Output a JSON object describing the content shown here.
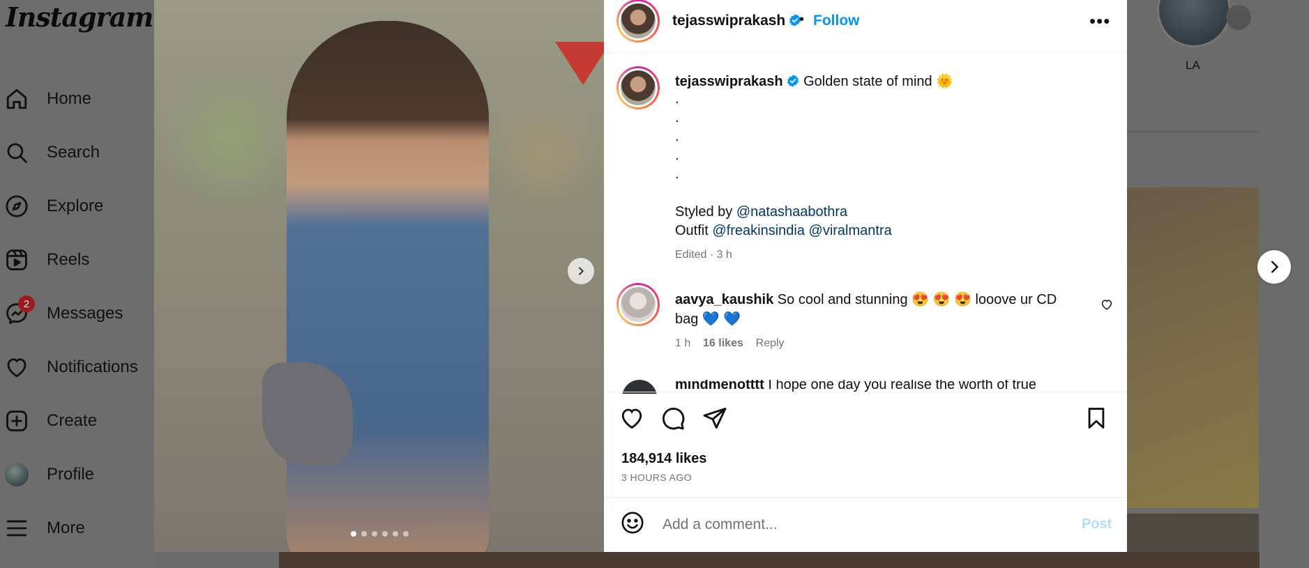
{
  "app": {
    "logo": "Instagram"
  },
  "sidebar": {
    "items": [
      {
        "label": "Home",
        "icon": "home-icon"
      },
      {
        "label": "Search",
        "icon": "search-icon"
      },
      {
        "label": "Explore",
        "icon": "compass-icon"
      },
      {
        "label": "Reels",
        "icon": "reels-icon"
      },
      {
        "label": "Messages",
        "icon": "messenger-icon",
        "badge": "2"
      },
      {
        "label": "Notifications",
        "icon": "heart-icon"
      },
      {
        "label": "Create",
        "icon": "plus-square-icon"
      },
      {
        "label": "Profile",
        "icon": "avatar"
      },
      {
        "label": "More",
        "icon": "menu-icon"
      }
    ]
  },
  "background": {
    "story_label": "LA"
  },
  "post": {
    "photo": {
      "slide_count": 6,
      "active_slide": 1
    },
    "header": {
      "username": "tejasswiprakash",
      "separator": "•",
      "follow_label": "Follow",
      "more_label": "•••"
    },
    "caption": {
      "username": "tejasswiprakash",
      "text": "Golden state of mind",
      "emoji": "🌞",
      "dots": [
        ".",
        ".",
        ".",
        ".",
        "."
      ],
      "styled_by_prefix": "Styled by",
      "styled_by_mention": "@natashaabothra",
      "outfit_prefix": "Outfit",
      "outfit_mentions": [
        "@freakinsindia",
        "@viralmantra"
      ],
      "meta": "Edited · 3 h"
    },
    "comments": [
      {
        "username": "aavya_kaushik",
        "text_line1": "So cool and stunning 😍 😍 😍  looove ur CD",
        "text_line2": "bag 💙 💙",
        "time": "1 h",
        "likes": "16 likes",
        "reply_label": "Reply"
      },
      {
        "username": "mindmenotttt",
        "text": "I hope one day you realise the worth of true"
      }
    ],
    "likes": "184,914 likes",
    "posted_ago": "3 HOURS AGO",
    "comment_box": {
      "placeholder": "Add a comment...",
      "post_label": "Post"
    }
  },
  "colors": {
    "accent": "#0095f6",
    "mention": "#00376b",
    "muted": "#737373",
    "badge": "#9c1a1d",
    "overlay": "#6b6b6b"
  }
}
